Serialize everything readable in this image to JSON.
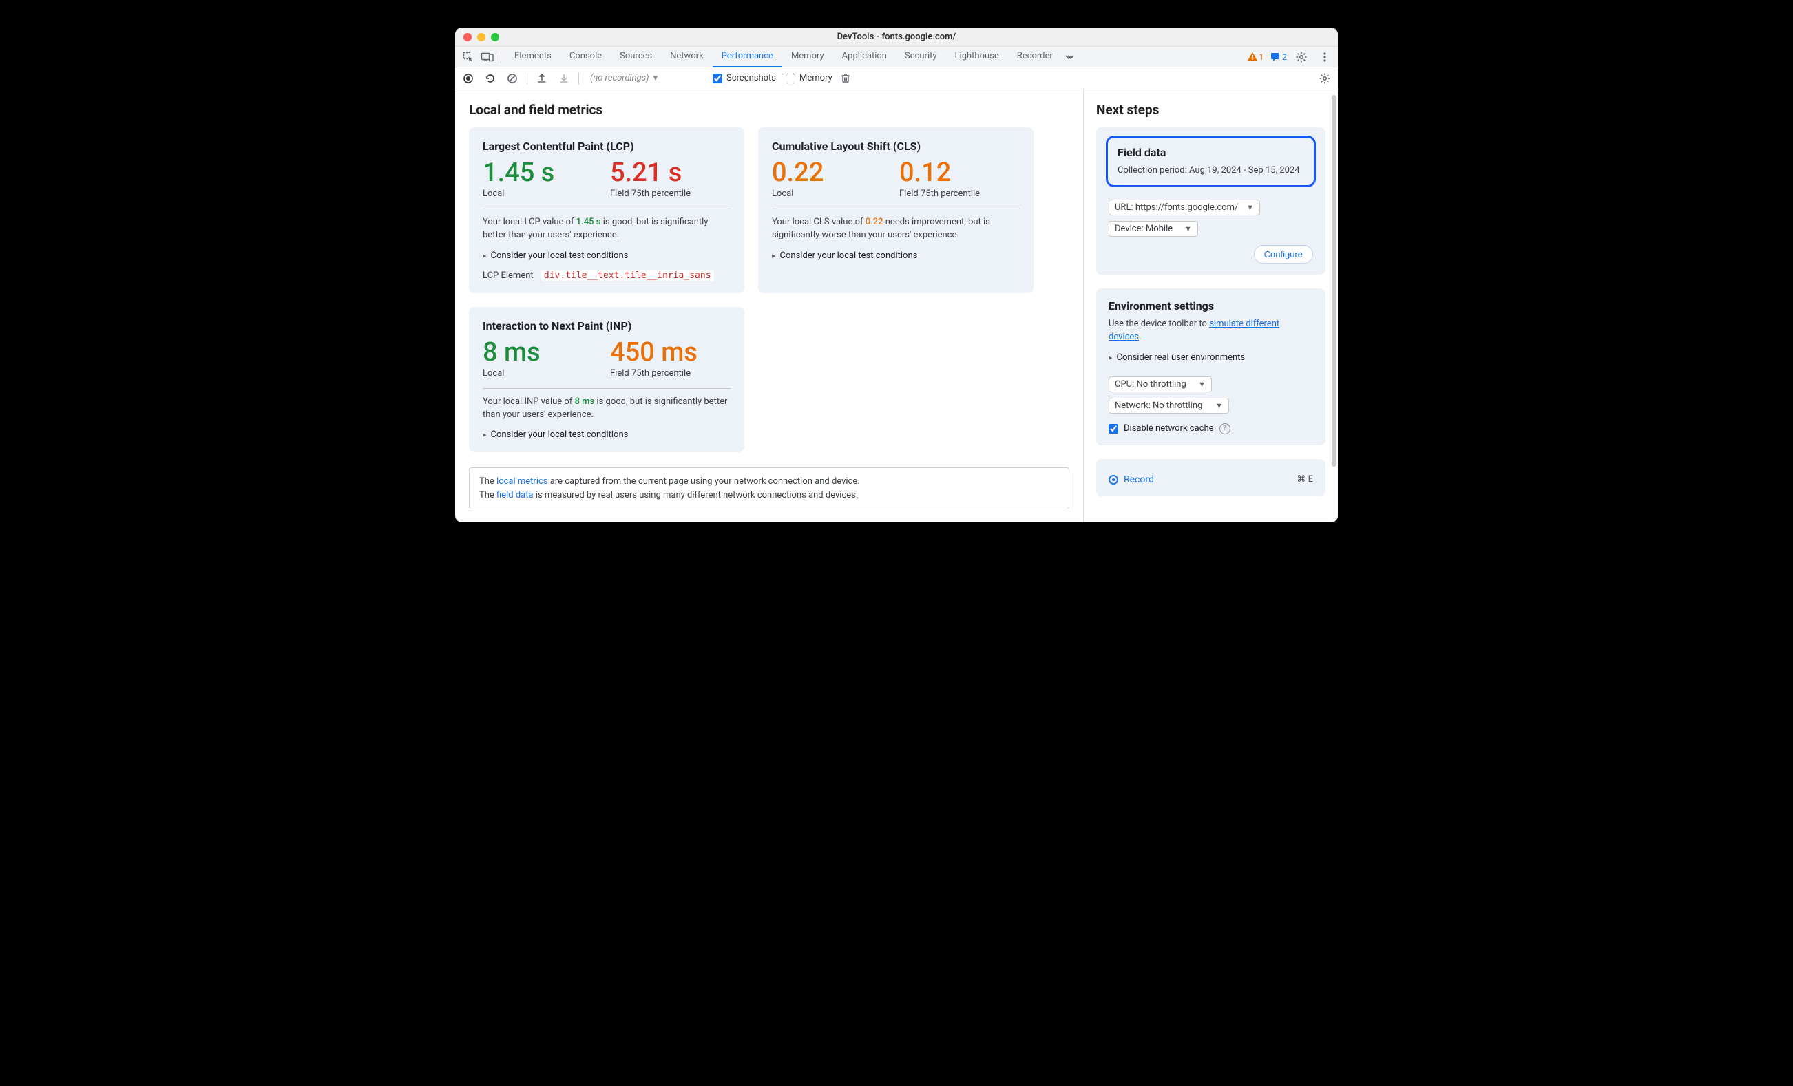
{
  "window": {
    "title": "DevTools - fonts.google.com/"
  },
  "tabs": {
    "items": [
      "Elements",
      "Console",
      "Sources",
      "Network",
      "Performance",
      "Memory",
      "Application",
      "Security",
      "Lighthouse",
      "Recorder"
    ],
    "active": "Performance",
    "warn_count": "1",
    "msg_count": "2"
  },
  "toolbar": {
    "recordings_placeholder": "(no recordings)",
    "screenshots_label": "Screenshots",
    "memory_label": "Memory"
  },
  "main": {
    "heading": "Local and field metrics",
    "lcp": {
      "title": "Largest Contentful Paint (LCP)",
      "local_value": "1.45 s",
      "local_label": "Local",
      "field_value": "5.21 s",
      "field_label": "Field 75th percentile",
      "para_pre": "Your local LCP value of ",
      "para_val": "1.45 s",
      "para_post": " is good, but is significantly better than your users' experience.",
      "disclosure": "Consider your local test conditions",
      "el_label": "LCP Element",
      "el_code": "div.tile__text.tile__inria_sans"
    },
    "cls": {
      "title": "Cumulative Layout Shift (CLS)",
      "local_value": "0.22",
      "local_label": "Local",
      "field_value": "0.12",
      "field_label": "Field 75th percentile",
      "para_pre": "Your local CLS value of ",
      "para_val": "0.22",
      "para_post": " needs improvement, but is significantly worse than your users' experience.",
      "disclosure": "Consider your local test conditions"
    },
    "inp": {
      "title": "Interaction to Next Paint (INP)",
      "local_value": "8 ms",
      "local_label": "Local",
      "field_value": "450 ms",
      "field_label": "Field 75th percentile",
      "para_pre": "Your local INP value of ",
      "para_val": "8 ms",
      "para_post": " is good, but is significantly better than your users' experience.",
      "disclosure": "Consider your local test conditions"
    },
    "footer": {
      "line1_pre": "The ",
      "line1_link": "local metrics",
      "line1_post": " are captured from the current page using your network connection and device.",
      "line2_pre": "The ",
      "line2_link": "field data",
      "line2_post": " is measured by real users using many different network connections and devices."
    }
  },
  "side": {
    "heading": "Next steps",
    "field": {
      "title": "Field data",
      "period_label": "Collection period: ",
      "period_value": "Aug 19, 2024 - Sep 15, 2024",
      "url_label": "URL: https://fonts.google.com/",
      "device_label": "Device: Mobile",
      "configure": "Configure"
    },
    "env": {
      "title": "Environment settings",
      "para_pre": "Use the device toolbar to ",
      "para_link": "simulate different devices",
      "para_post": ".",
      "disclosure": "Consider real user environments",
      "cpu_label": "CPU: No throttling",
      "net_label": "Network: No throttling",
      "cache_label": "Disable network cache"
    },
    "record": {
      "label": "Record",
      "shortcut": "⌘ E"
    }
  }
}
